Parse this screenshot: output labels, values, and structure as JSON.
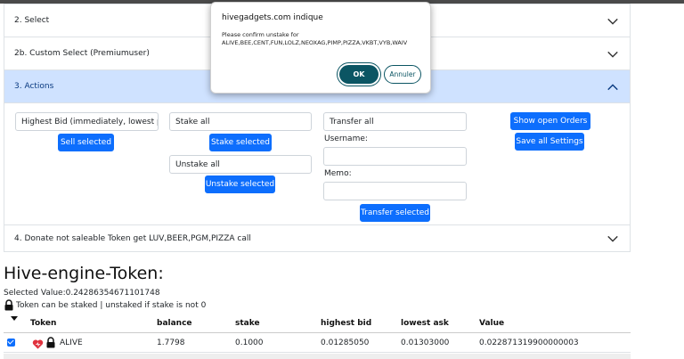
{
  "accordion": {
    "items": [
      {
        "label": "2. Select"
      },
      {
        "label": "2b. Custom Select (Premiumuser)"
      },
      {
        "label": "3. Actions"
      },
      {
        "label": "4. Donate not saleable Token get LUV,BEER,PGM,PIZZA call"
      }
    ]
  },
  "actions": {
    "sell_mode_select": "Highest Bid (immediately, lowest prof",
    "sell_button": "Sell selected",
    "stake_select": "Stake all",
    "stake_button": "Stake selected",
    "unstake_select": "Unstake all",
    "unstake_button": "Unstake selected",
    "transfer_select": "Transfer all",
    "username_label": "Username:",
    "username_value": "",
    "memo_label": "Memo:",
    "memo_value": "",
    "transfer_button": "Transfer selected",
    "show_orders_button": "Show open Orders",
    "save_settings_button": "Save all Settings"
  },
  "tokens_section": {
    "title": "Hive-engine-Token:",
    "selected_value": "Selected Value:0.24286354671101748",
    "note": "Token can be staked | unstaked if stake is not 0",
    "columns": [
      "Token",
      "balance",
      "stake",
      "highest bid",
      "lowest ask",
      "Value"
    ],
    "rows": [
      {
        "checked": true,
        "token": "ALIVE",
        "balance": "1.7798",
        "stake": "0.1000",
        "highest_bid": "0.01285050",
        "lowest_ask": "0.01303000",
        "value": "0.022871319900000003"
      }
    ]
  },
  "dialog": {
    "title": "hivegadgets.com indique",
    "message_line1": "Please confirm unstake for",
    "message_line2": "ALIVE,BEE,CENT,FUN,LOLZ,NEOXAG,PIMP,PIZZA,VKBT,VYB,WAIV",
    "ok_label": "OK",
    "cancel_label": "Annuler"
  },
  "colors": {
    "primary": "#0d6efd",
    "accordion_active_bg": "#cfe2ff",
    "dialog_accent": "#0b5563"
  },
  "icons": {
    "chevron": "chevron-icon",
    "lock": "lock-icon",
    "heart": "heart-icon"
  }
}
